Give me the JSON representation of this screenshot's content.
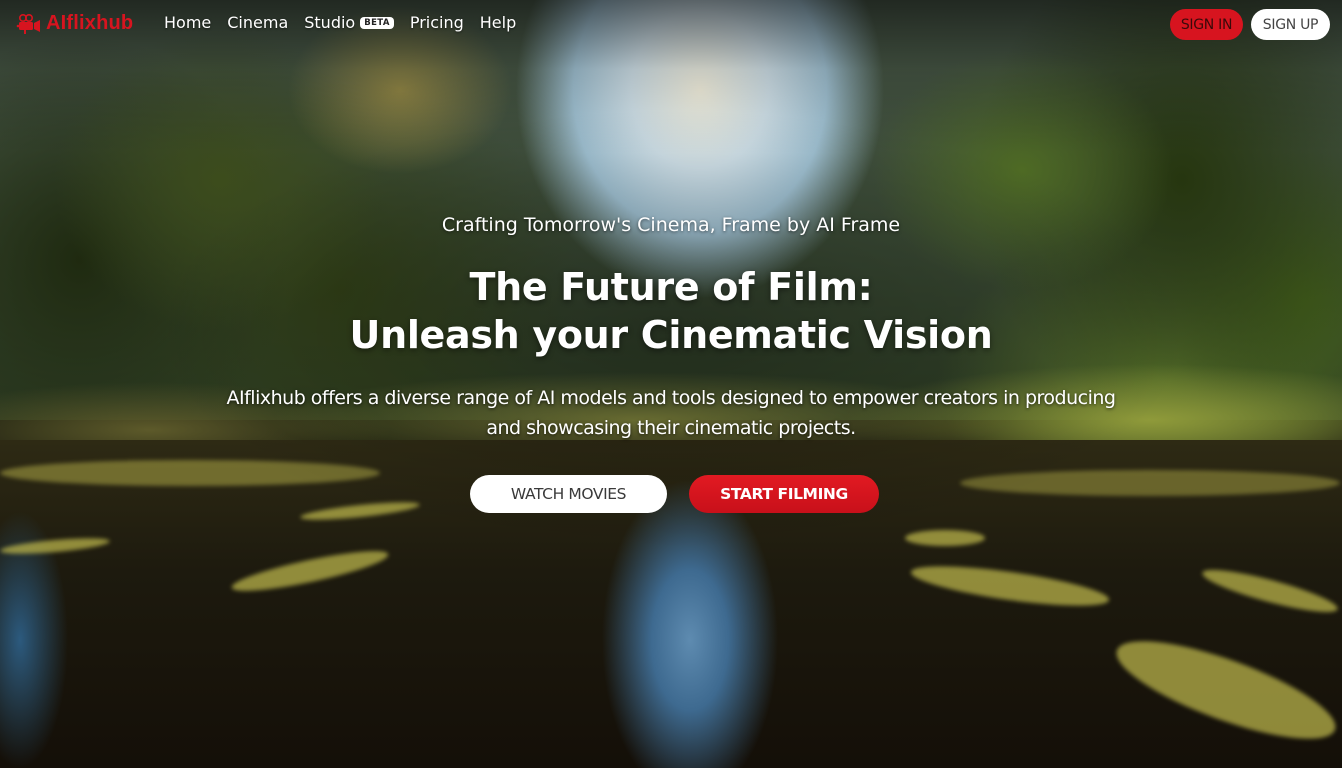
{
  "brand": {
    "name": "AIflixhub",
    "logo_icon": "film-camera-icon",
    "accent_color": "#d7141f"
  },
  "nav": {
    "links": [
      {
        "label": "Home"
      },
      {
        "label": "Cinema"
      },
      {
        "label": "Studio",
        "badge": "BETA"
      },
      {
        "label": "Pricing"
      },
      {
        "label": "Help"
      }
    ]
  },
  "auth": {
    "sign_in": "SIGN IN",
    "sign_up": "SIGN UP"
  },
  "hero": {
    "tagline": "Crafting Tomorrow's Cinema, Frame by AI Frame",
    "headline_line1": "The Future of Film:",
    "headline_line2": "Unleash your Cinematic Vision",
    "description": "AIflixhub offers a diverse range of AI models and tools designed to empower creators in producing and showcasing their cinematic projects.",
    "cta_secondary": "WATCH MOVIES",
    "cta_primary": "START FILMING",
    "background": "jungle-river-video"
  }
}
